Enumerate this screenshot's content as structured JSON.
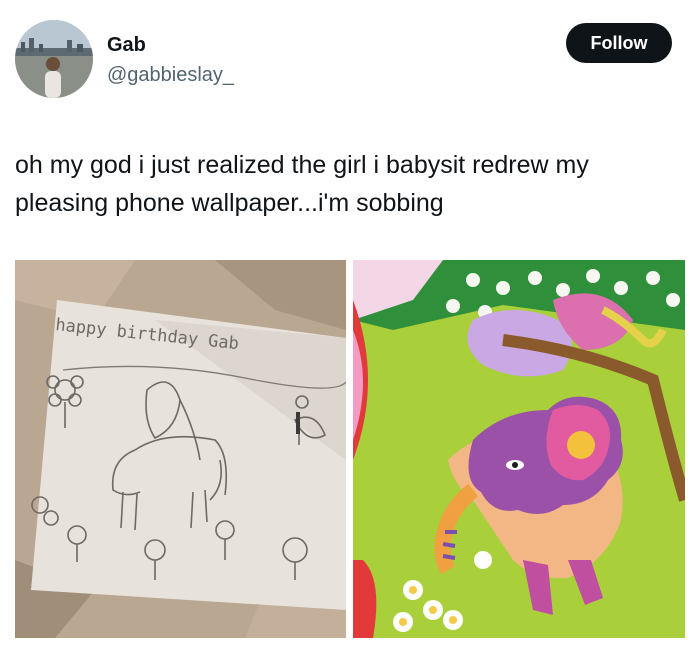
{
  "user": {
    "name": "Gab",
    "handle": "@gabbieslay_"
  },
  "follow_label": "Follow",
  "tweet": {
    "text": "oh my god i just realized the girl i babysit redrew my pleasing phone wallpaper...i'm sobbing"
  },
  "media": {
    "drawing_text": "happy birthday Gab"
  },
  "colors": {
    "follow_bg": "#0f1419",
    "handle": "#536471"
  }
}
